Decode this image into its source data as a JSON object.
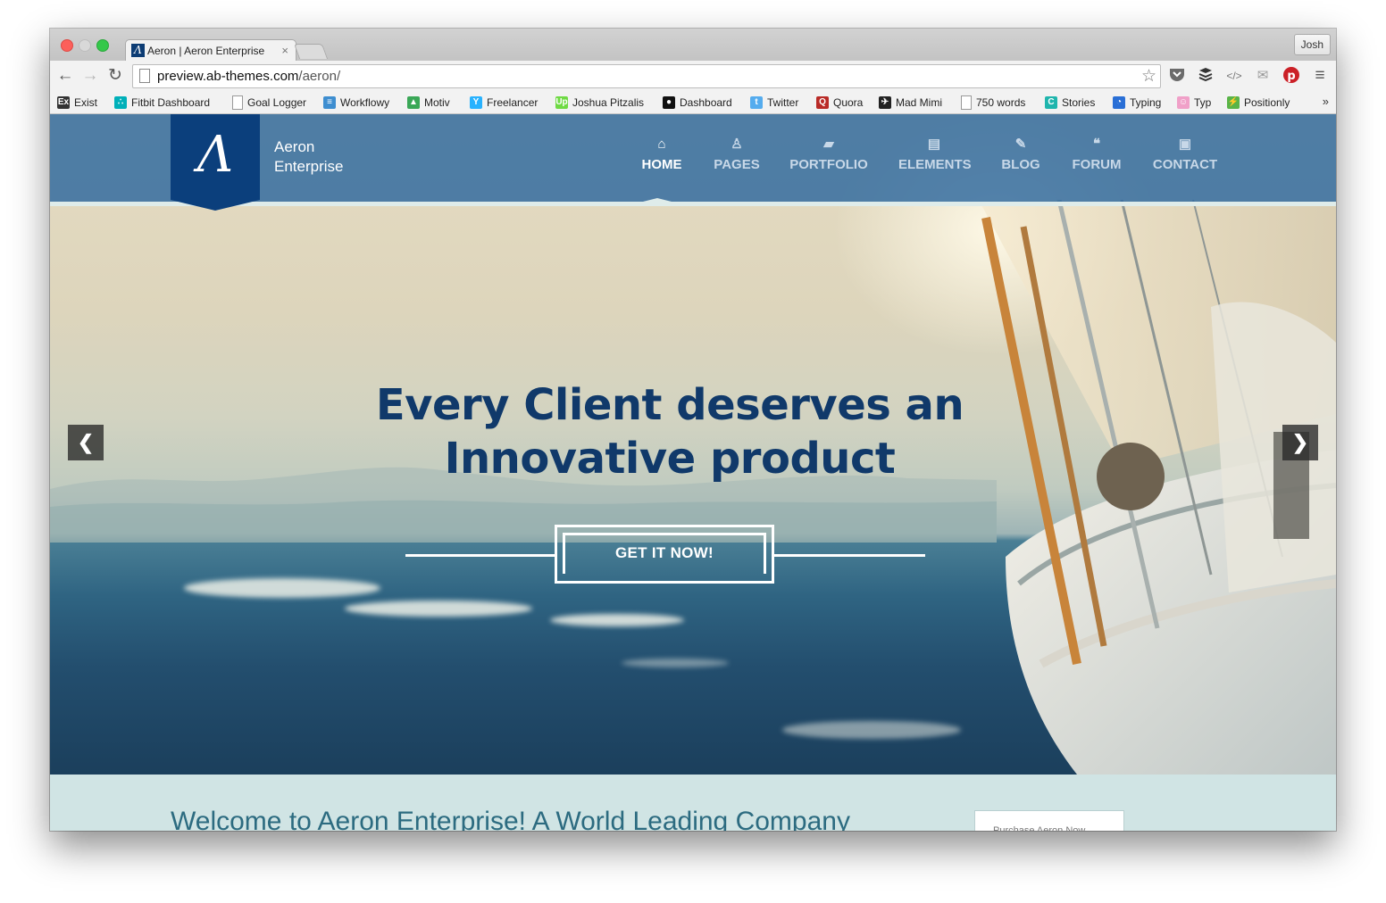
{
  "browser": {
    "tab_title": "Aeron | Aeron Enterprise",
    "tab_close": "×",
    "profile_name": "Josh",
    "url_host": "preview.ab-themes.com",
    "url_path": "/aeron/",
    "nav_back": "←",
    "nav_forward": "→",
    "nav_reload": "↻",
    "menu_icon": "≡"
  },
  "bookmarks": [
    {
      "label": "Exist",
      "icon": "Ex",
      "color": "#333333"
    },
    {
      "label": "Fitbit Dashboard",
      "icon": "∴",
      "color": "#00b0b9"
    },
    {
      "label": "Goal Logger",
      "icon": "",
      "color": "#ffffff"
    },
    {
      "label": "Workflowy",
      "icon": "≡",
      "color": "#3e8ed0"
    },
    {
      "label": "Motiv",
      "icon": "▲",
      "color": "#3aa757"
    },
    {
      "label": "Freelancer",
      "icon": "Y",
      "color": "#29b2fe"
    },
    {
      "label": "Joshua Pitzalis",
      "icon": "Up",
      "color": "#6fda44"
    },
    {
      "label": "Dashboard",
      "icon": "●",
      "color": "#111111"
    },
    {
      "label": "Twitter",
      "icon": "t",
      "color": "#55acee"
    },
    {
      "label": "Quora",
      "icon": "Q",
      "color": "#b92b27"
    },
    {
      "label": "Mad Mimi",
      "icon": "✈",
      "color": "#222222"
    },
    {
      "label": "750 words",
      "icon": "",
      "color": "#ffffff"
    },
    {
      "label": "Stories",
      "icon": "C",
      "color": "#1fb5ad"
    },
    {
      "label": "Typing",
      "icon": "◔",
      "color": "#2a6fd6"
    },
    {
      "label": "Typ",
      "icon": "☺",
      "color": "#f0a0c8"
    },
    {
      "label": "Positionly",
      "icon": "⚡",
      "color": "#59b448"
    }
  ],
  "bookmarks_more": "»",
  "site": {
    "logo_glyph": "Λ",
    "brand_line1": "Aeron",
    "brand_line2": "Enterprise",
    "nav": [
      {
        "label": "HOME",
        "icon": "⌂",
        "active": true
      },
      {
        "label": "PAGES",
        "icon": "♙",
        "active": false
      },
      {
        "label": "PORTFOLIO",
        "icon": "▰",
        "active": false
      },
      {
        "label": "ELEMENTS",
        "icon": "▤",
        "active": false
      },
      {
        "label": "BLOG",
        "icon": "✎",
        "active": false
      },
      {
        "label": "FORUM",
        "icon": "❝",
        "active": false
      },
      {
        "label": "CONTACT",
        "icon": "▣",
        "active": false
      }
    ],
    "hero_line1": "Every Client deserves an",
    "hero_line2": "Innovative product",
    "cta_label": "GET IT NOW!",
    "prev_arrow": "❮",
    "next_arrow": "❯",
    "welcome_text": "Welcome to Aeron Enterprise! A World Leading Company",
    "side_box_text": "Purchase Aeron Now"
  },
  "colors": {
    "header_bg": "#2d689e",
    "logo_bg": "#0b3f7c",
    "headline": "#10396a",
    "welcome_band": "#d0e4e4",
    "welcome_text": "#2c6b80"
  }
}
